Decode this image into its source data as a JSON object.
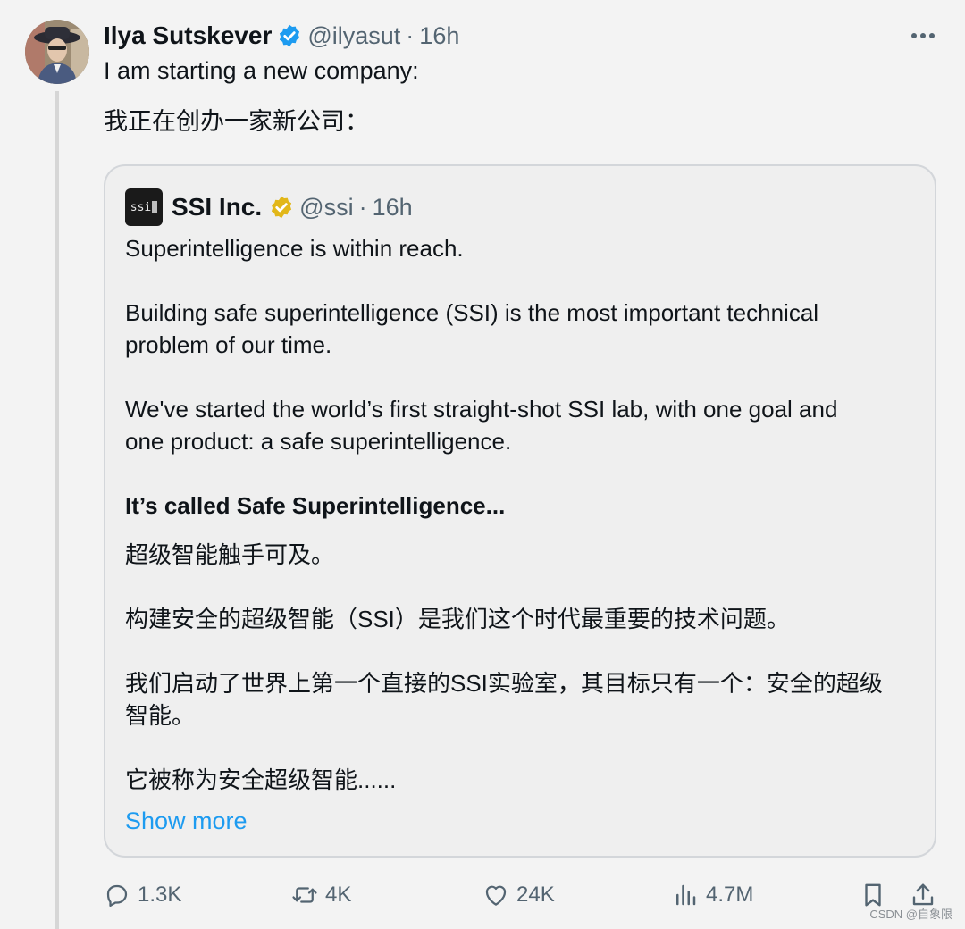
{
  "tweet": {
    "author_name": "Ilya Sutskever",
    "handle": "@ilyasut",
    "time": "16h",
    "separator": "·",
    "text_line_1": "I am starting a new company:",
    "text_line_2": "我正在创办一家新公司："
  },
  "quote": {
    "logo_text": "ssi",
    "author_name": "SSI Inc.",
    "handle": "@ssi",
    "time": "16h",
    "lines": [
      "Superintelligence is within reach.",
      "Building safe superintelligence (SSI) is the most important technical",
      "problem of our time.",
      "We've started the world’s first straight-shot SSI lab, with one goal and",
      "one product: a safe superintelligence.",
      "It’s called Safe Superintelligence...",
      "超级智能触手可及。",
      "构建安全的超级智能（SSI）是我们这个时代最重要的技术问题。",
      "我们启动了世界上第一个直接的SSI实验室，其目标只有一个：安全的超级",
      "智能。",
      "它被称为安全超级智能......"
    ],
    "show_more": "Show more"
  },
  "actions": {
    "replies": "1.3K",
    "reposts": "4K",
    "likes": "24K",
    "views": "4.7M"
  },
  "icons": {
    "more": "more-horizontal-icon",
    "reply": "reply-icon",
    "repost": "repost-icon",
    "like": "like-icon",
    "views": "views-icon",
    "bookmark": "bookmark-icon",
    "share": "share-icon",
    "verified_blue": "verified-badge-icon",
    "verified_gold": "gold-verified-badge-icon"
  },
  "colors": {
    "link": "#1d9bf0",
    "verified_blue": "#1d9bf0",
    "verified_gold": "#e2b719",
    "muted": "#536471"
  },
  "watermark": "CSDN @自象限"
}
